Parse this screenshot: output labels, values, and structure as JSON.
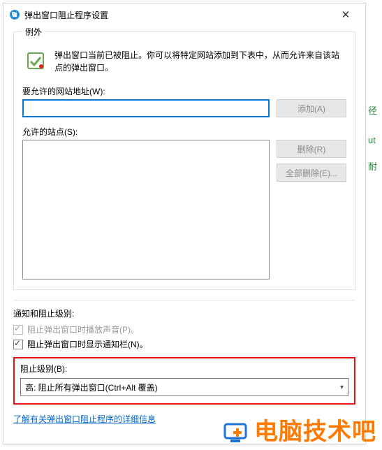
{
  "window": {
    "title": "弹出窗口阻止程序设置",
    "close_glyph": "✕"
  },
  "exceptions": {
    "legend": "例外",
    "info": "弹出窗口当前已被阻止。你可以将特定网站添加到下表中，从而允许来自该站点的弹出窗口。",
    "address_label": "要允许的网站地址(W):",
    "address_value": "",
    "add_btn": "添加(A)",
    "sites_label": "允许的站点(S):",
    "remove_btn": "删除(R)",
    "remove_all_btn": "全部删除(E)..."
  },
  "notify": {
    "section_title": "通知和阻止级别:",
    "play_sound": "阻止弹出窗口时播放声音(P)。",
    "show_bar": "阻止弹出窗口时显示通知栏(N)。"
  },
  "level": {
    "label": "阻止级别(B):",
    "selected": "高: 阻止所有弹出窗口(Ctrl+Alt 覆盖)"
  },
  "link": {
    "learn_more": "了解有关弹出窗口阻止程序的详细信息"
  },
  "bg": {
    "c1": "径",
    "c2": "ut",
    "c3": "耐"
  },
  "watermark": {
    "text": "电脑技术吧"
  }
}
